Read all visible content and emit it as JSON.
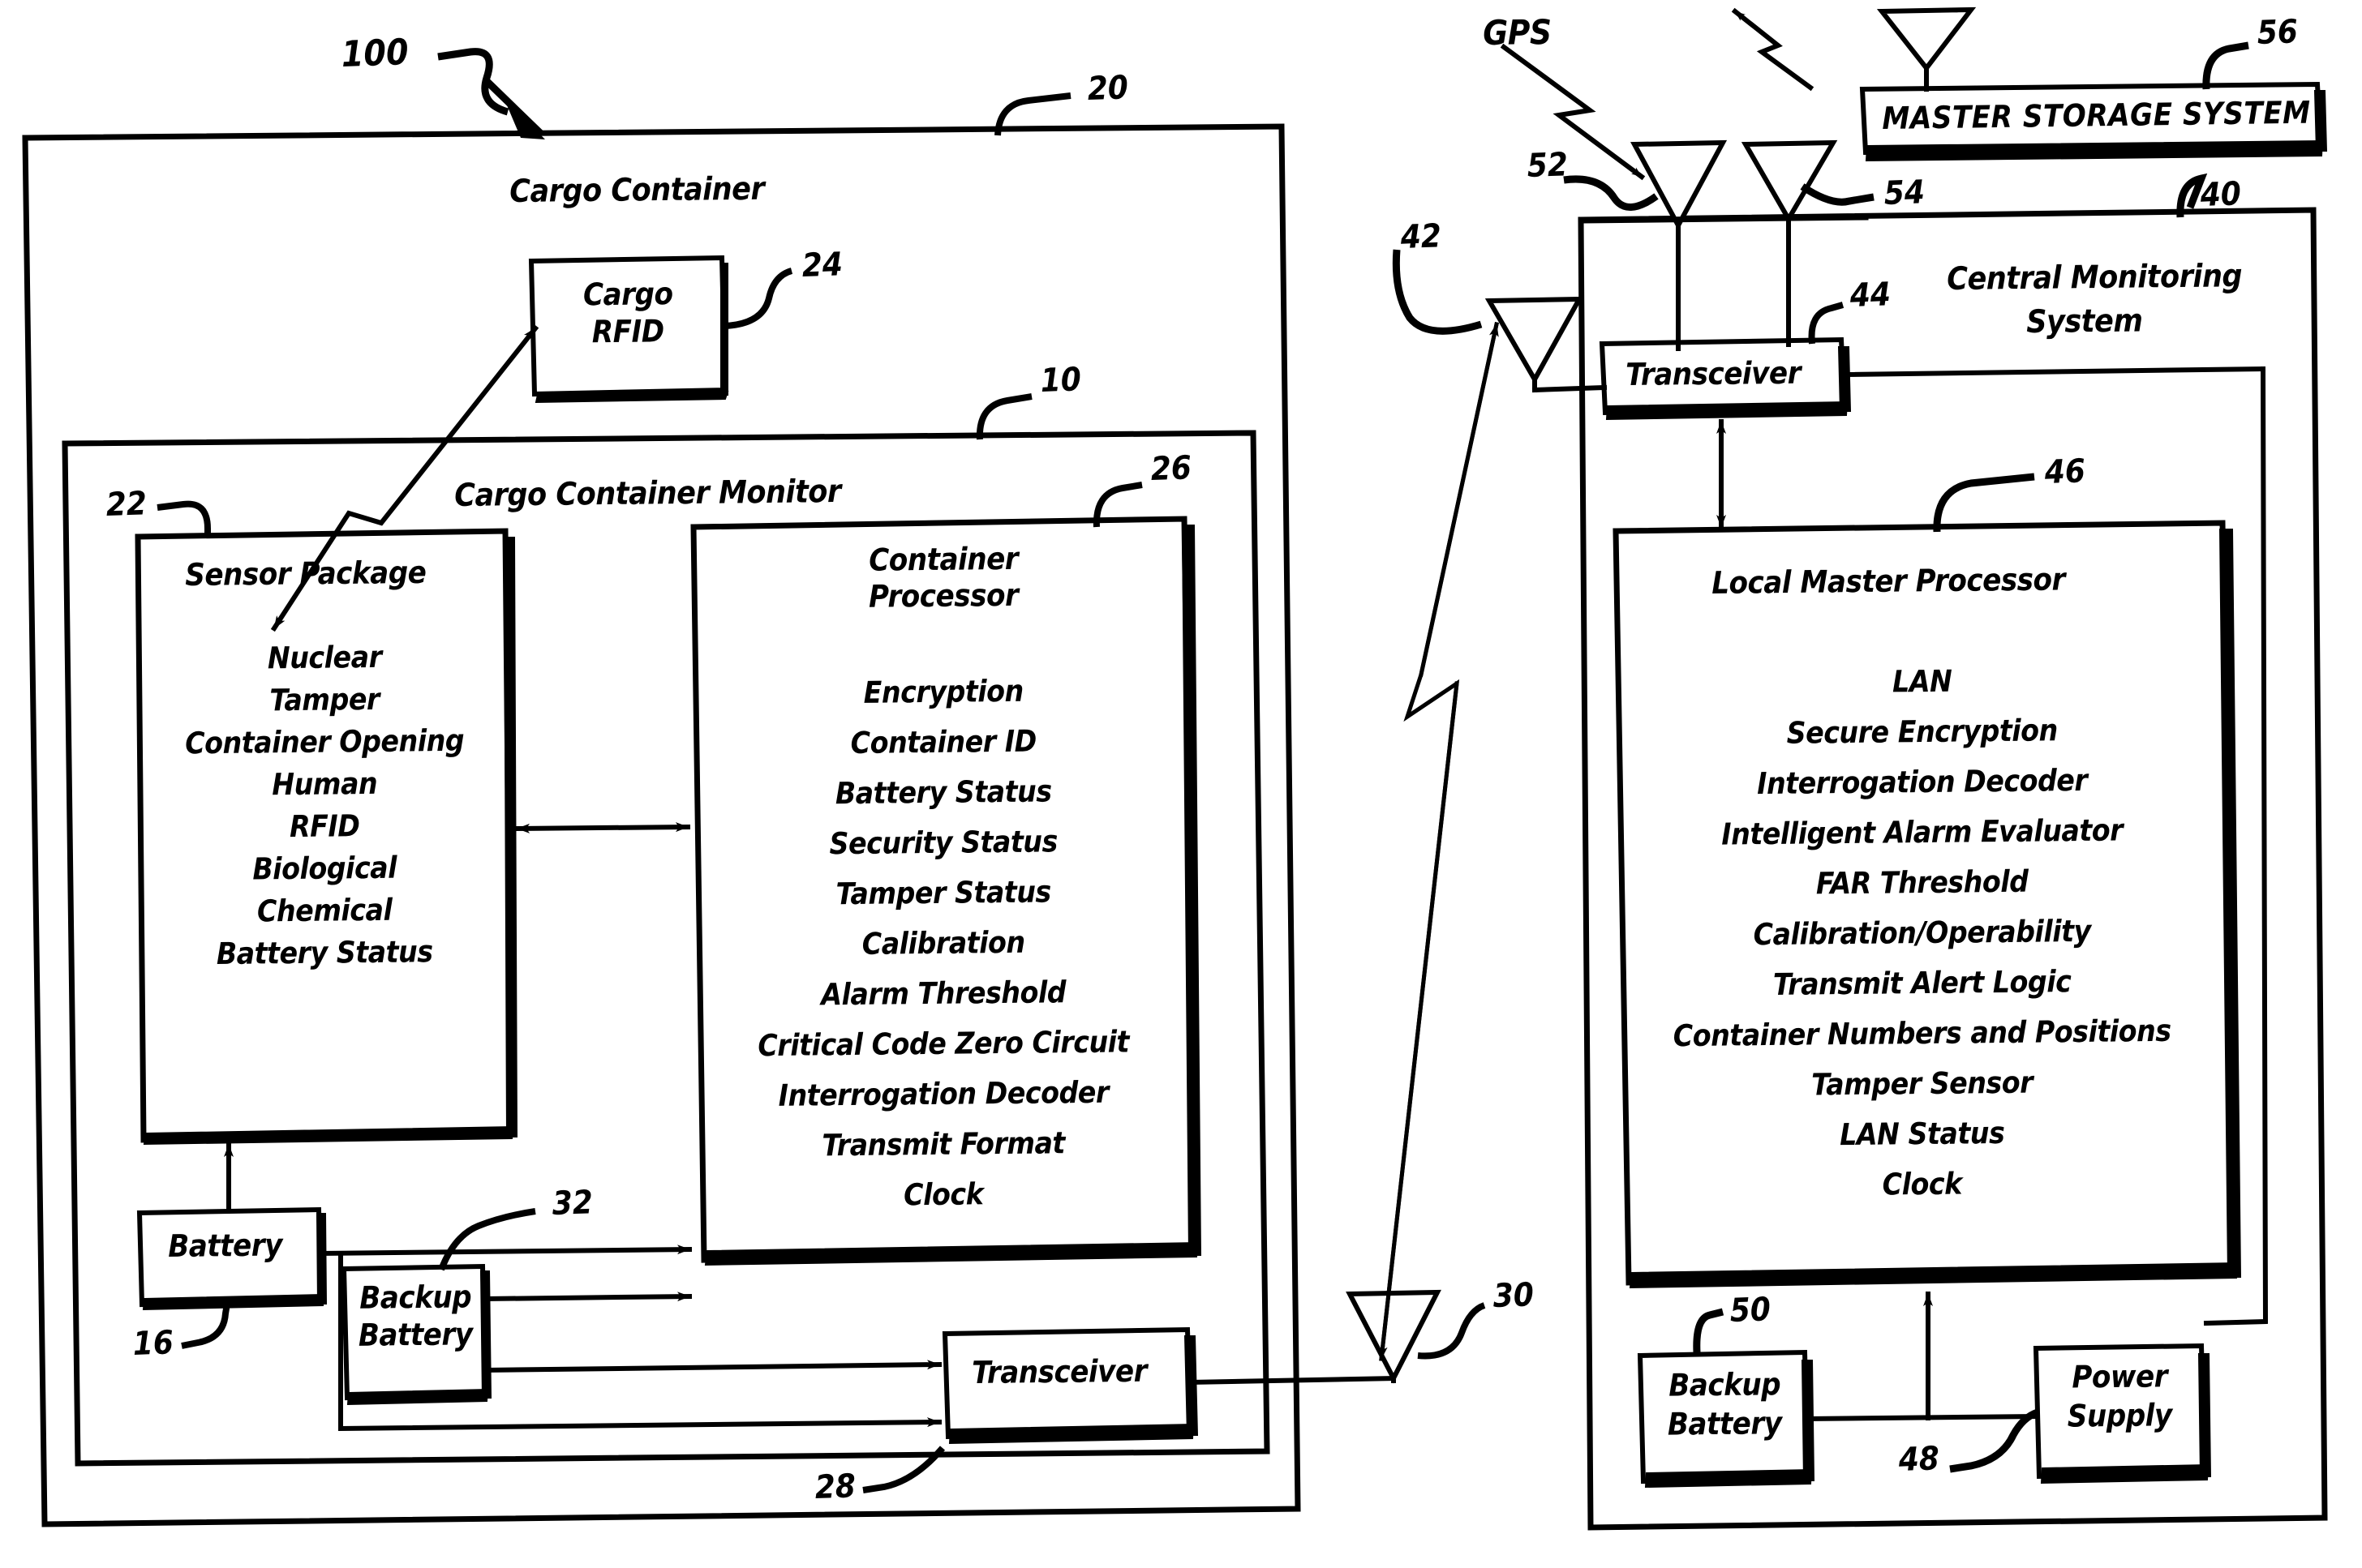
{
  "figure": {
    "ref_100": "100",
    "gps_label": "GPS"
  },
  "cargo_container": {
    "title": "Cargo Container",
    "ref": "20",
    "cargo_rfid": {
      "line1": "Cargo",
      "line2": "RFID",
      "ref": "24"
    },
    "monitor": {
      "title": "Cargo Container Monitor",
      "ref": "10",
      "sensor_package": {
        "title": "Sensor Package",
        "ref": "22",
        "items": [
          "Nuclear",
          "Tamper",
          "Container Opening",
          "Human",
          "RFID",
          "Biological",
          "Chemical",
          "Battery Status"
        ]
      },
      "container_processor": {
        "title_line1": "Container",
        "title_line2": "Processor",
        "ref": "26",
        "items": [
          "Encryption",
          "Container ID",
          "Battery Status",
          "Security Status",
          "Tamper Status",
          "Calibration",
          "Alarm Threshold",
          "Critical Code Zero Circuit",
          "Interrogation Decoder",
          "Transmit Format",
          "Clock"
        ]
      },
      "battery": {
        "label": "Battery",
        "ref": "16"
      },
      "backup_battery": {
        "line1": "Backup",
        "line2": "Battery",
        "ref": "32"
      },
      "transceiver": {
        "label": "Transceiver",
        "ref": "28"
      },
      "antenna": {
        "ref": "30"
      }
    }
  },
  "central_monitoring": {
    "title_line1": "Central Monitoring",
    "title_line2": "System",
    "ref": "40",
    "antenna_42": {
      "ref": "42"
    },
    "antenna_52": {
      "ref": "52"
    },
    "antenna_54": {
      "ref": "54"
    },
    "transceiver": {
      "label": "Transceiver",
      "ref": "44"
    },
    "local_master_processor": {
      "title": "Local Master Processor",
      "ref": "46",
      "items": [
        "LAN",
        "Secure Encryption",
        "Interrogation Decoder",
        "Intelligent Alarm Evaluator",
        "FAR Threshold",
        "Calibration/Operability",
        "Transmit Alert Logic",
        "Container Numbers and Positions",
        "Tamper Sensor",
        "LAN Status",
        "Clock"
      ]
    },
    "backup_battery": {
      "line1": "Backup",
      "line2": "Battery",
      "ref": "50"
    },
    "power_supply": {
      "line1": "Power",
      "line2": "Supply",
      "ref": "48"
    }
  },
  "master_storage_system": {
    "label": "MASTER STORAGE SYSTEM",
    "ref": "56"
  },
  "colors": {
    "ink": "#000000",
    "paper": "#ffffff"
  }
}
